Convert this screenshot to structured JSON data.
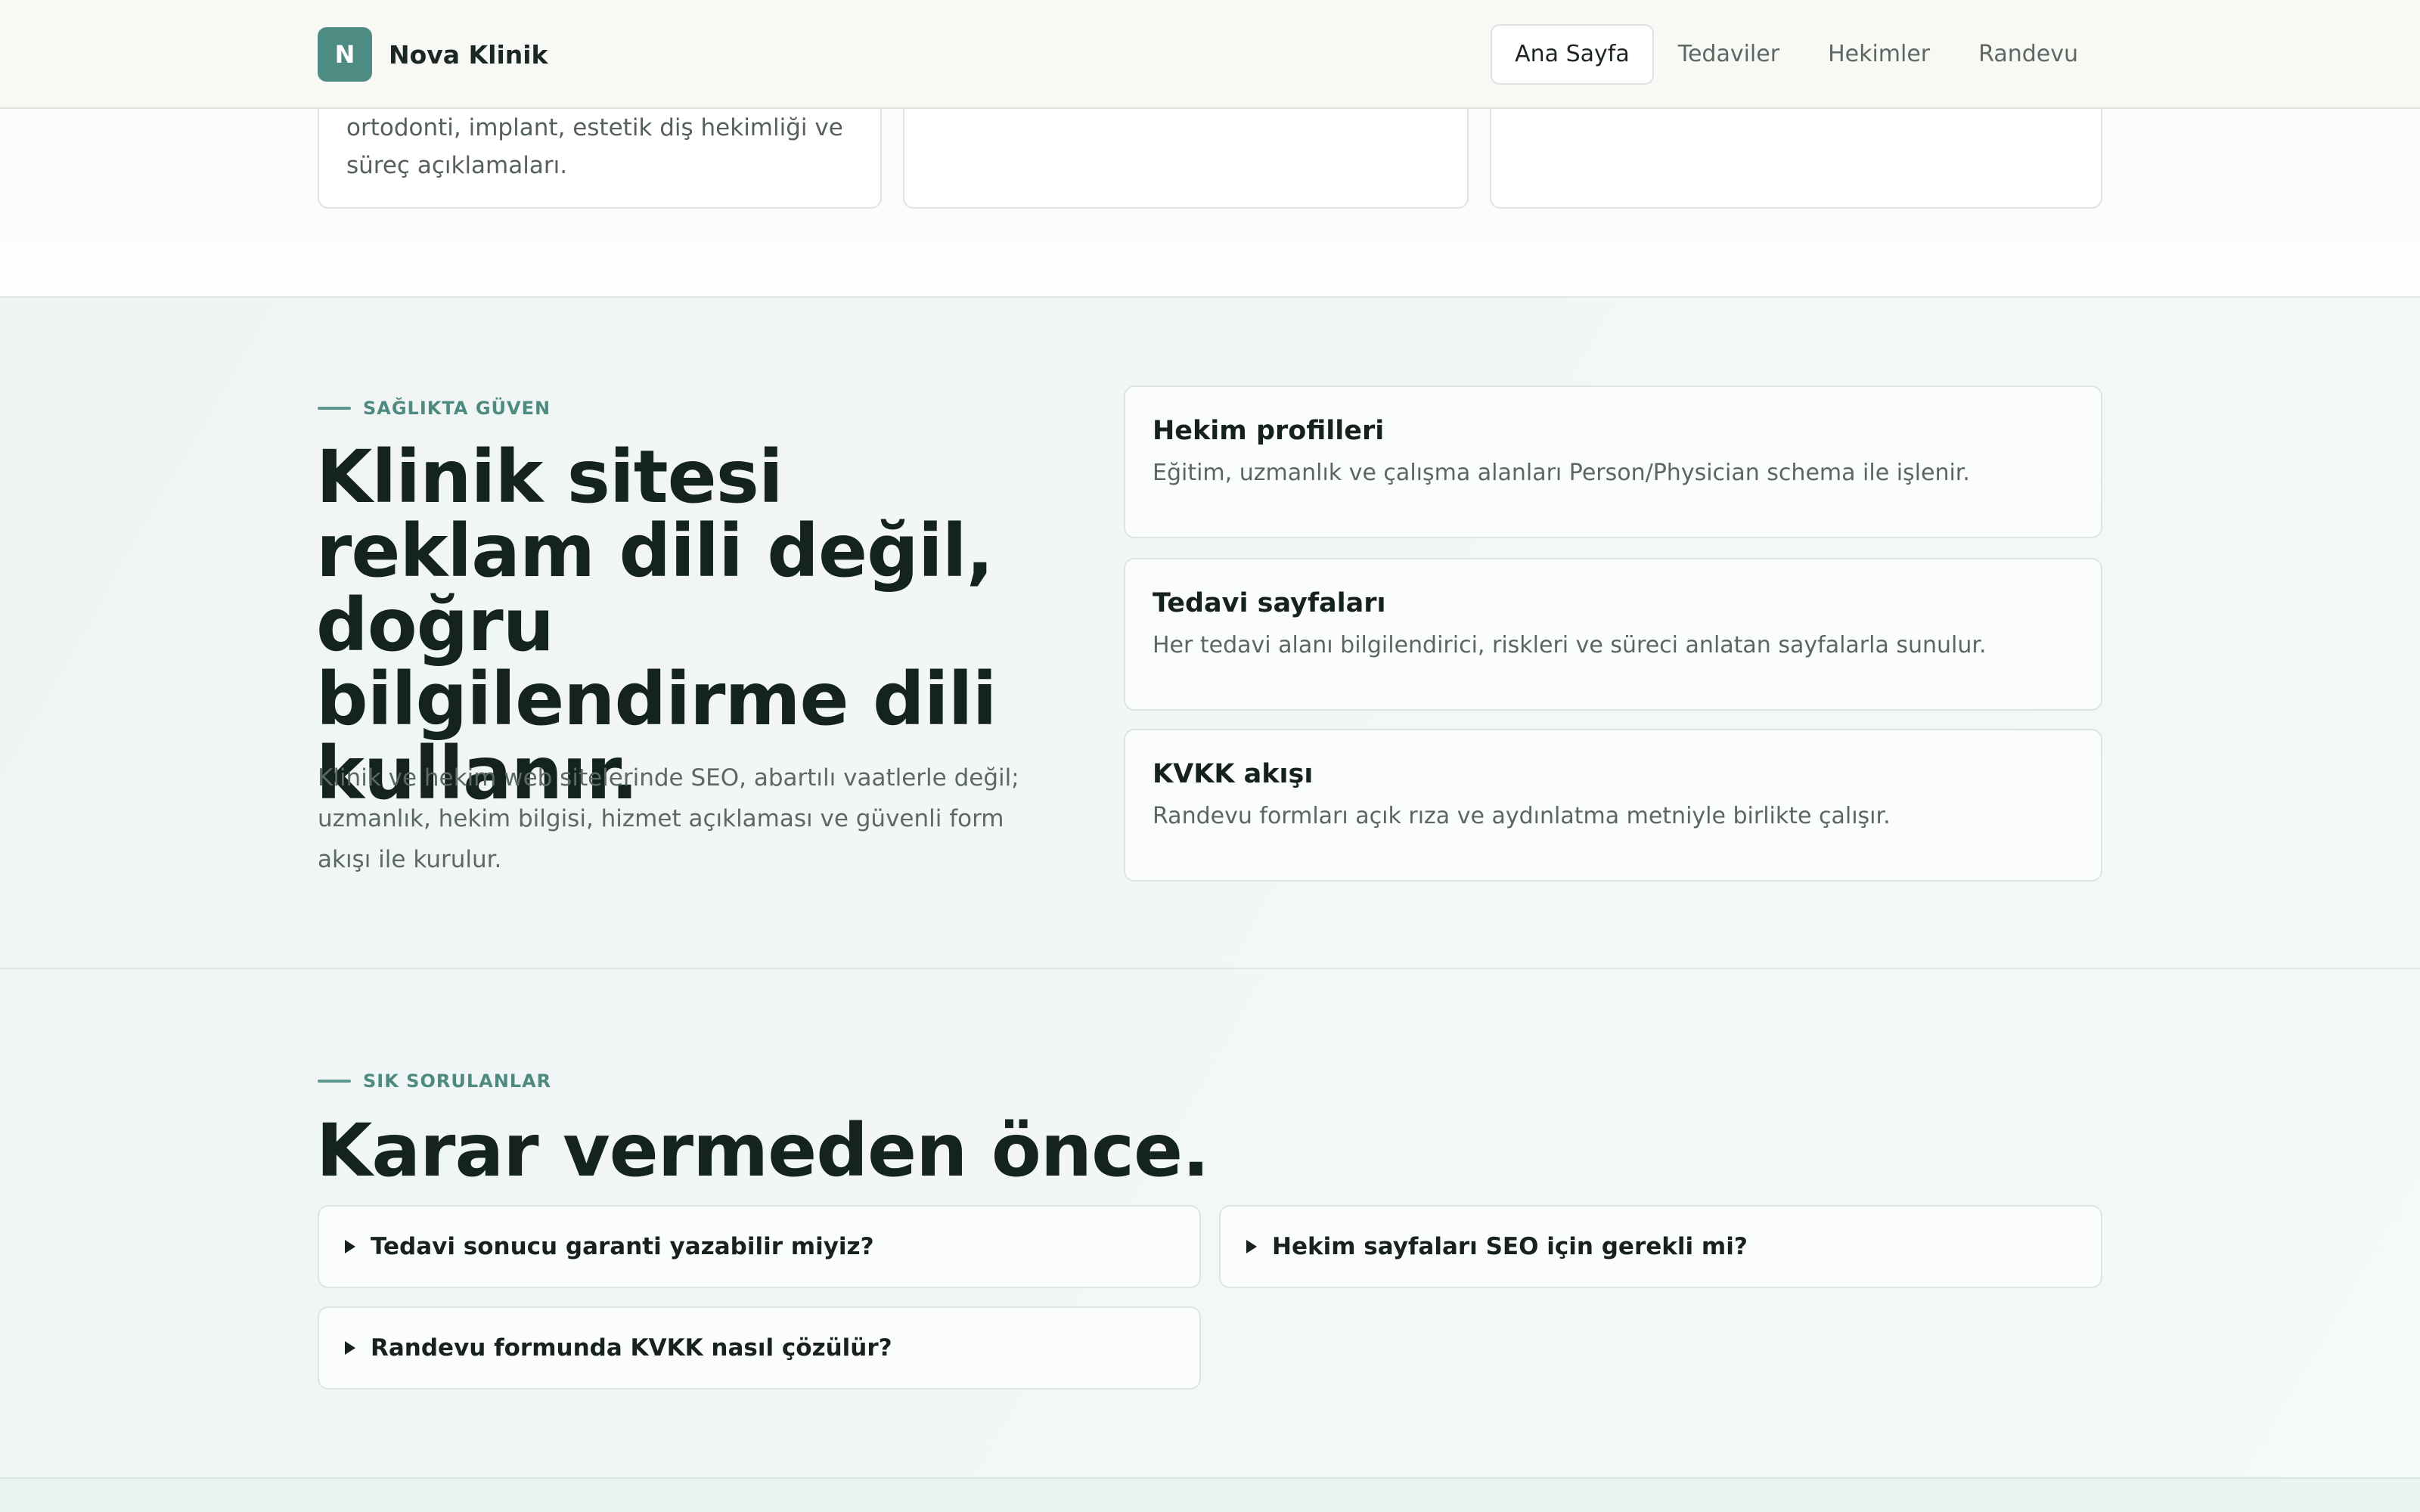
{
  "header": {
    "logo_letter": "N",
    "brand": "Nova Klinik",
    "nav": [
      "Ana Sayfa",
      "Tedaviler",
      "Hekimler",
      "Randevu"
    ],
    "active_nav": "Ana Sayfa"
  },
  "top_cards": {
    "card1_text": "ortodonti, implant, estetik diş hekimliği ve süreç açıklamaları."
  },
  "trust": {
    "eyebrow": "SAĞLIKTA GÜVEN",
    "title": "Klinik sitesi reklam dili değil, doğru bilgilendirme dili kullanır.",
    "description": "Klinik ve hekim web sitelerinde SEO, abartılı vaatlerle değil; uzmanlık, hekim bilgisi, hizmet açıklaması ve güvenli form akışı ile kurulur.",
    "features": [
      {
        "title": "Hekim profilleri",
        "text": "Eğitim, uzmanlık ve çalışma alanları Person/Physician schema ile işlenir."
      },
      {
        "title": "Tedavi sayfaları",
        "text": "Her tedavi alanı bilgilendirici, riskleri ve süreci anlatan sayfalarla sunulur."
      },
      {
        "title": "KVKK akışı",
        "text": "Randevu formları açık rıza ve aydınlatma metniyle birlikte çalışır."
      }
    ]
  },
  "faq": {
    "eyebrow": "SIK SORULANLAR",
    "title": "Karar vermeden önce.",
    "questions": [
      "Tedavi sonucu garanti yazabilir miyiz?",
      "Hekim sayfaları SEO için gerekli mi?",
      "Randevu formunda KVKK nasıl çözülür?"
    ]
  },
  "colors": {
    "accent": "#4e8b82",
    "heading": "#14231f",
    "muted_text": "#5c6866",
    "card_border": "#dce5e3"
  },
  "icons": {
    "faq_toggle": "triangle-right-icon"
  }
}
